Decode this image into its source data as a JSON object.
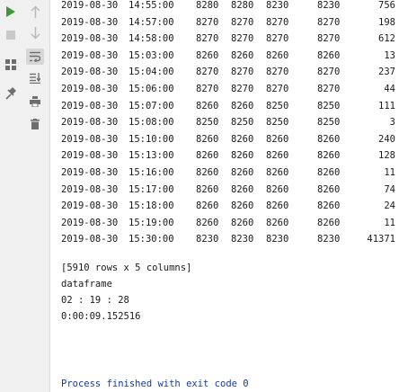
{
  "toolbar_left": {
    "icons": [
      "run-icon",
      "stop-icon",
      "layout-icon",
      "pin-icon"
    ]
  },
  "toolbar_right": {
    "icons": [
      "up-arrow-icon",
      "down-arrow-icon",
      "soft-wrap-icon",
      "scroll-to-end-icon",
      "print-icon",
      "trash-icon"
    ]
  },
  "table": {
    "rows": [
      {
        "date": "2019-08-30",
        "time": "14:55:00",
        "v1": "8280",
        "v2": "8280",
        "v3": "8230",
        "v4": "8230",
        "vol": "756"
      },
      {
        "date": "2019-08-30",
        "time": "14:57:00",
        "v1": "8270",
        "v2": "8270",
        "v3": "8270",
        "v4": "8270",
        "vol": "198"
      },
      {
        "date": "2019-08-30",
        "time": "14:58:00",
        "v1": "8270",
        "v2": "8270",
        "v3": "8270",
        "v4": "8270",
        "vol": "612"
      },
      {
        "date": "2019-08-30",
        "time": "15:03:00",
        "v1": "8260",
        "v2": "8260",
        "v3": "8260",
        "v4": "8260",
        "vol": "13"
      },
      {
        "date": "2019-08-30",
        "time": "15:04:00",
        "v1": "8270",
        "v2": "8270",
        "v3": "8270",
        "v4": "8270",
        "vol": "237"
      },
      {
        "date": "2019-08-30",
        "time": "15:06:00",
        "v1": "8270",
        "v2": "8270",
        "v3": "8270",
        "v4": "8270",
        "vol": "44"
      },
      {
        "date": "2019-08-30",
        "time": "15:07:00",
        "v1": "8260",
        "v2": "8260",
        "v3": "8250",
        "v4": "8250",
        "vol": "111"
      },
      {
        "date": "2019-08-30",
        "time": "15:08:00",
        "v1": "8250",
        "v2": "8250",
        "v3": "8250",
        "v4": "8250",
        "vol": "3"
      },
      {
        "date": "2019-08-30",
        "time": "15:10:00",
        "v1": "8260",
        "v2": "8260",
        "v3": "8260",
        "v4": "8260",
        "vol": "240"
      },
      {
        "date": "2019-08-30",
        "time": "15:13:00",
        "v1": "8260",
        "v2": "8260",
        "v3": "8260",
        "v4": "8260",
        "vol": "128"
      },
      {
        "date": "2019-08-30",
        "time": "15:16:00",
        "v1": "8260",
        "v2": "8260",
        "v3": "8260",
        "v4": "8260",
        "vol": "11"
      },
      {
        "date": "2019-08-30",
        "time": "15:17:00",
        "v1": "8260",
        "v2": "8260",
        "v3": "8260",
        "v4": "8260",
        "vol": "74"
      },
      {
        "date": "2019-08-30",
        "time": "15:18:00",
        "v1": "8260",
        "v2": "8260",
        "v3": "8260",
        "v4": "8260",
        "vol": "24"
      },
      {
        "date": "2019-08-30",
        "time": "15:19:00",
        "v1": "8260",
        "v2": "8260",
        "v3": "8260",
        "v4": "8260",
        "vol": "11"
      },
      {
        "date": "2019-08-30",
        "time": "15:30:00",
        "v1": "8230",
        "v2": "8230",
        "v3": "8230",
        "v4": "8230",
        "vol": "41371"
      }
    ]
  },
  "output": {
    "shape": "[5910 rows x 5 columns]",
    "label": "dataframe",
    "clock": "02 : 19 : 28",
    "elapsed": "0:00:09.152516",
    "process": "Process finished with exit code 0"
  },
  "colors": {
    "run": "#3c9a3c",
    "icon": "#6e6e6e",
    "icon_disabled": "#b9b9b9",
    "gutter": "#f0f0f0",
    "process_text": "#1a3d8f"
  }
}
